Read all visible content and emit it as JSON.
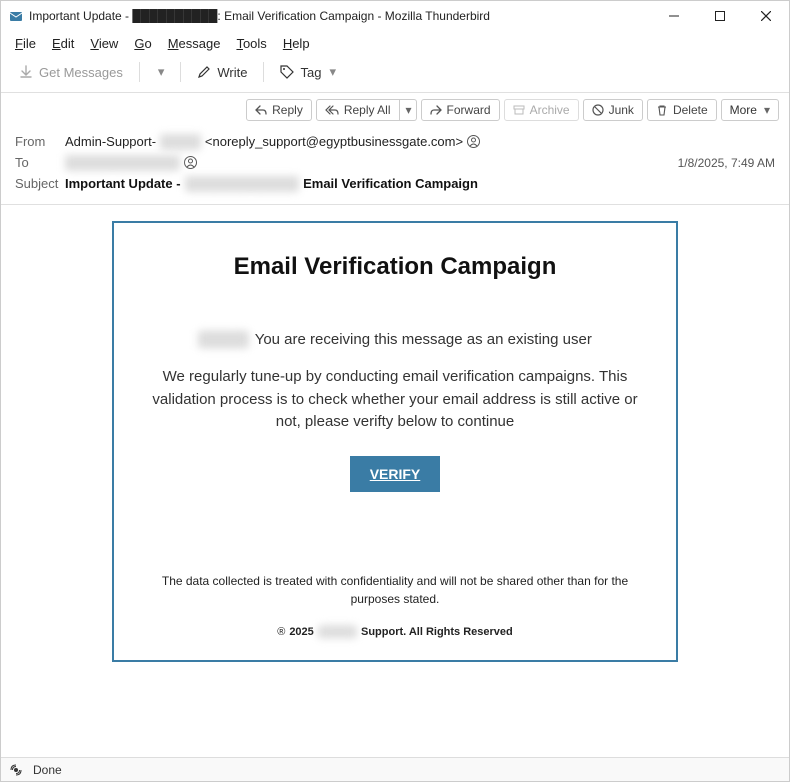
{
  "window": {
    "title": "Important Update - ██████████: Email Verification Campaign - Mozilla Thunderbird"
  },
  "menubar": [
    "File",
    "Edit",
    "View",
    "Go",
    "Message",
    "Tools",
    "Help"
  ],
  "toolbar": {
    "get_messages": "Get Messages",
    "write": "Write",
    "tag": "Tag"
  },
  "actions": {
    "reply": "Reply",
    "reply_all": "Reply All",
    "forward": "Forward",
    "archive": "Archive",
    "junk": "Junk",
    "delete": "Delete",
    "more": "More"
  },
  "headers": {
    "from_label": "From",
    "from_name_prefix": "Admin-Support-",
    "from_name_hidden": "████",
    "from_email": "<noreply_support@egyptbusinessgate.com>",
    "to_label": "To",
    "to_hidden": "████████████",
    "date": "1/8/2025, 7:49 AM",
    "subject_label": "Subject",
    "subject_prefix": "Important Update - ",
    "subject_hidden": "████████████",
    "subject_suffix": " Email Verification Campaign"
  },
  "mail": {
    "heading": "Email Verification Campaign",
    "greet_hidden": "████",
    "greet_text": "You are receiving this message as an existing user",
    "paragraph": "We regularly tune-up by conducting email verification campaigns. This validation process is to check whether your email address is still active or not, please verifty below to continue",
    "button": "VERIFY",
    "disclaimer": "The data collected is treated with confidentiality and will not be shared  other  than for the purposes stated.",
    "copy_symbol": "®",
    "copy_year": "2025",
    "copy_hidden": "████",
    "copy_suffix": "Support. All Rights Reserved"
  },
  "status": {
    "text": "Done"
  }
}
